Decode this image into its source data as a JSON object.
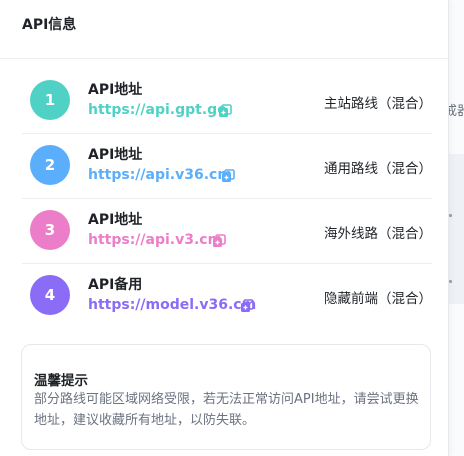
{
  "panel": {
    "title": "API信息"
  },
  "background": {
    "peek_text": "戒器"
  },
  "routes": [
    {
      "number": "1",
      "label": "API地址",
      "url": "https://api.gpt.ge",
      "note": "主站路线（混合）",
      "color": "#4fd1c5",
      "copy_icon": "copy-icon"
    },
    {
      "number": "2",
      "label": "API地址",
      "url": "https://api.v36.cm",
      "note": "通用路线（混合）",
      "color": "#5aaefc",
      "copy_icon": "copy-icon"
    },
    {
      "number": "3",
      "label": "API地址",
      "url": "https://api.v3.cm",
      "note": "海外线路（混合）",
      "color": "#ec7ec9",
      "copy_icon": "copy-icon"
    },
    {
      "number": "4",
      "label": "API备用",
      "url": "https://model.v36.cm",
      "note": "隐藏前端（混合）",
      "color": "#8b6cf6",
      "copy_icon": "copy-icon"
    }
  ],
  "tip": {
    "title": "温馨提示",
    "text": "部分路线可能区域网络受限，若无法正常访问API地址，请尝试更换地址，建议收藏所有地址，以防失联。"
  }
}
